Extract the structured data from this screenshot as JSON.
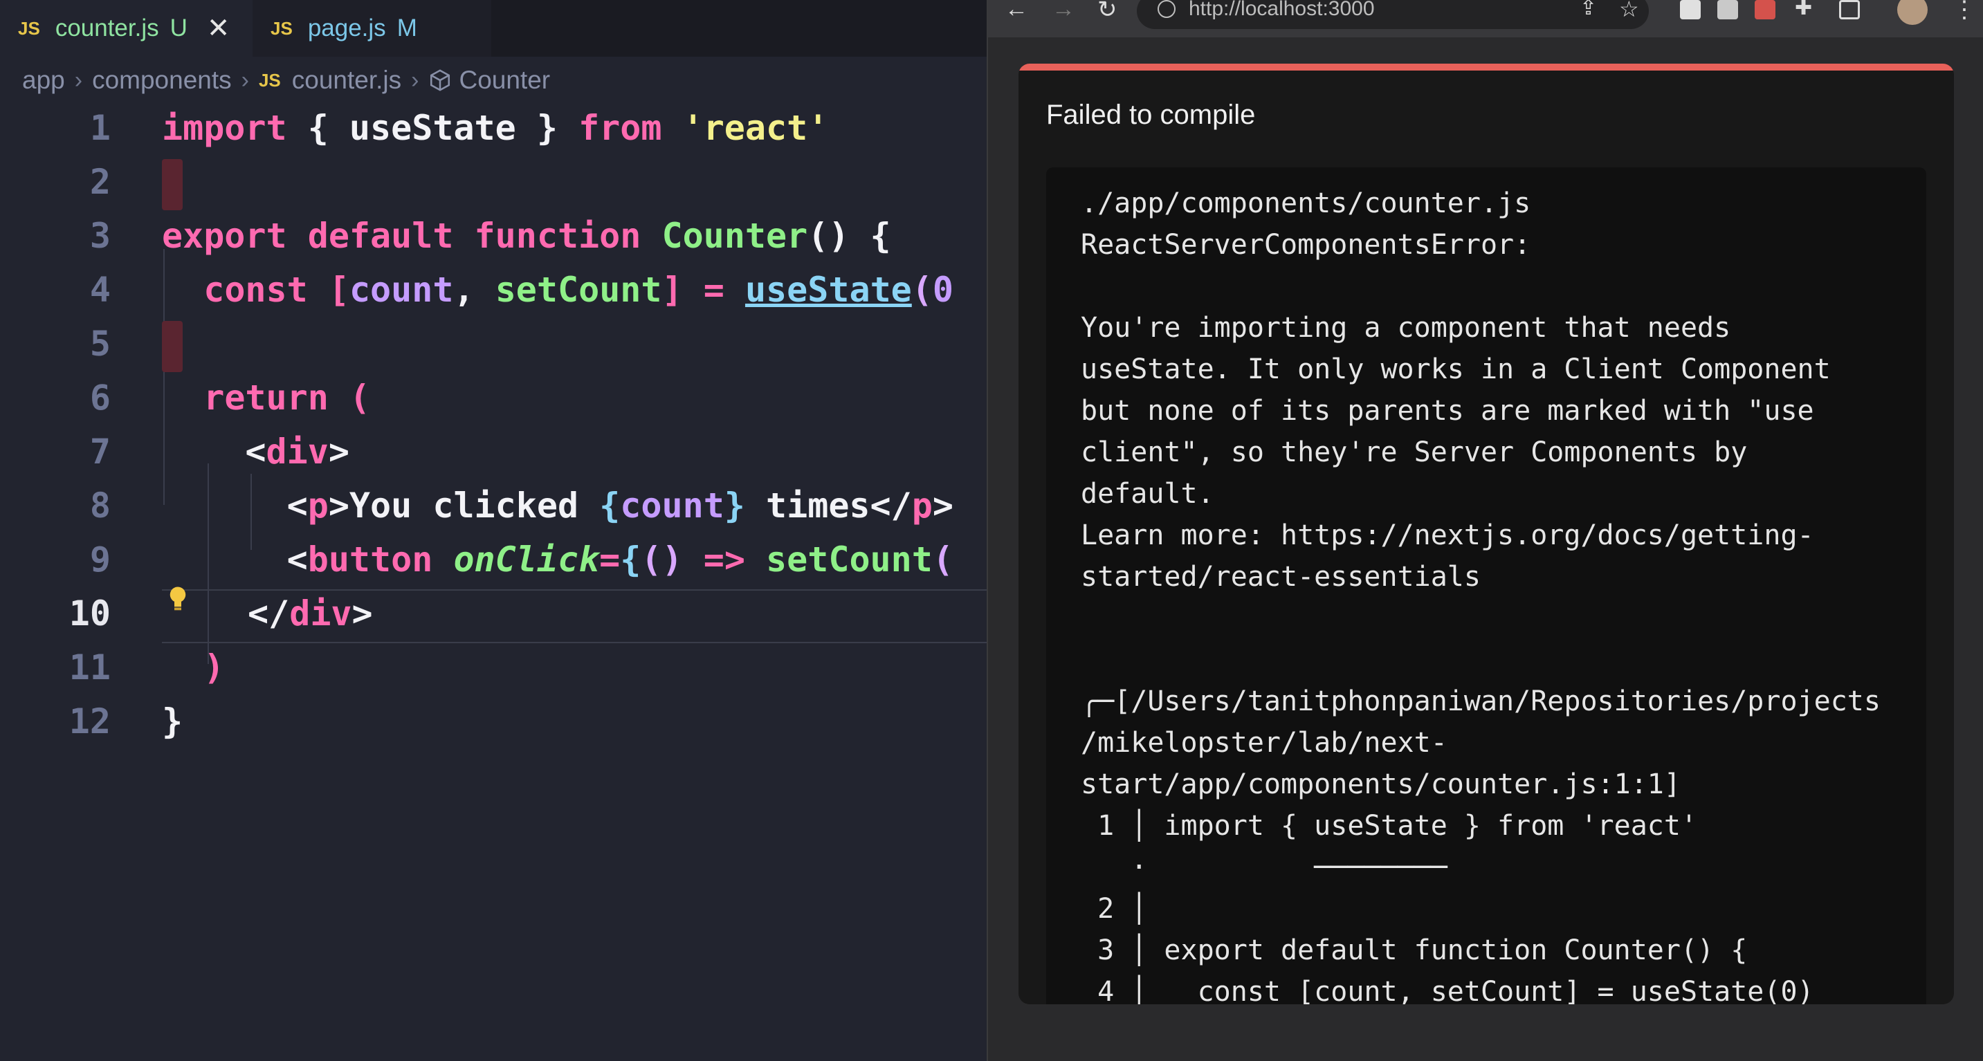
{
  "editor": {
    "tabs": [
      {
        "icon": "JS",
        "name": "counter.js",
        "status": "U",
        "close": "✕"
      },
      {
        "icon": "JS",
        "name": "page.js",
        "status": "M"
      }
    ],
    "breadcrumb": [
      "app",
      "components",
      "counter.js",
      "Counter"
    ],
    "breadcrumb_js": "JS",
    "line_numbers": [
      "1",
      "2",
      "3",
      "4",
      "5",
      "6",
      "7",
      "8",
      "9",
      "10",
      "11",
      "12"
    ],
    "current_line": "10"
  },
  "browser": {
    "url": "http://localhost:3000",
    "overlay_title": "Failed to compile",
    "error_lines": [
      "./app/components/counter.js",
      "ReactServerComponentsError:",
      "",
      "You're importing a component that needs",
      "useState. It only works in a Client Component",
      "but none of its parents are marked with \"use",
      "client\", so they're Server Components by",
      "default.",
      "Learn more: https://nextjs.org/docs/getting-",
      "started/react-essentials",
      "",
      "",
      "╭─[/Users/tanitphonpaniwan/Repositories/projects",
      "/mikelopster/lab/next-",
      "start/app/components/counter.js:1:1]",
      " 1 │ import { useState } from 'react'",
      "   ·          ────────",
      " 2 │",
      " 3 │ export default function Counter() {",
      " 4 │   const [count, setCount] = useState(0)"
    ]
  },
  "colors": {
    "editor_bg": "#22242f",
    "keyword": "#ff6ab0",
    "function": "#8ff088",
    "string": "#f4f08c",
    "variable": "#c59cff",
    "error_accent": "#e8615a"
  }
}
